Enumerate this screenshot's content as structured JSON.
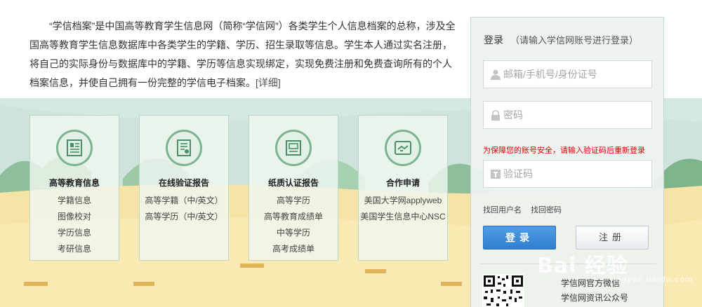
{
  "intro": {
    "text": "“学信档案”是中国高等教育学生信息网（简称“学信网”）各类学生个人信息档案的总称，涉及全国高等教育学生信息数据库中各类学生的学籍、学历、招生录取等信息。学生本人通过实名注册，将自己的实际身份与数据库中的学籍、学历等信息实现绑定，实现免费注册和免费查询所有的个人档案信息，并使自己拥有一份完整的学信电子档案。",
    "more": "[详细]"
  },
  "cards": [
    {
      "title": "高等教育信息",
      "icon": "student-record-icon",
      "items": [
        "学籍信息",
        "图像校对",
        "学历信息",
        "考研信息"
      ]
    },
    {
      "title": "在线验证报告",
      "icon": "verification-report-icon",
      "items": [
        "高等学籍（中/英文）",
        "高等学历（中/英文）"
      ]
    },
    {
      "title": "纸质认证报告",
      "icon": "paper-certificate-icon",
      "items": [
        "高等学历",
        "高等教育成绩单",
        "中等学历",
        "高考成绩单"
      ]
    },
    {
      "title": "合作申请",
      "icon": "handshake-icon",
      "items": [
        "美国大学网applyweb",
        "美国学生信息中心NSC"
      ]
    }
  ],
  "login": {
    "title": "登录",
    "subtitle": "（请输入学信网账号进行登录）",
    "username_placeholder": "邮箱/手机号/身份证号",
    "password_placeholder": "密码",
    "warning": "为保障您的账号安全，请输入验证码后重新登录",
    "captcha_placeholder": "验证码",
    "find_username": "找回用户名",
    "find_password": "找回密码",
    "login_button": "登录",
    "register_button": "注册",
    "qr_line1": "学信网官方微信",
    "qr_line2": "学信网资讯公众号"
  },
  "watermark": {
    "text": "Bai 经验",
    "sub": "jingyan.baidu.com"
  },
  "colors": {
    "accent": "#2f7fd0",
    "warning": "#e00000",
    "card_border": "#b9d8c1",
    "icon_green": "#7bb393"
  }
}
